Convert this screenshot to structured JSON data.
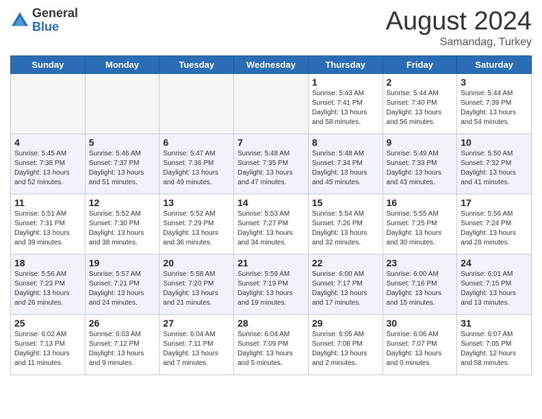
{
  "header": {
    "logo_general": "General",
    "logo_blue": "Blue",
    "title": "August 2024",
    "location": "Samandag, Turkey"
  },
  "days_of_week": [
    "Sunday",
    "Monday",
    "Tuesday",
    "Wednesday",
    "Thursday",
    "Friday",
    "Saturday"
  ],
  "weeks": [
    [
      {
        "day": "",
        "info": ""
      },
      {
        "day": "",
        "info": ""
      },
      {
        "day": "",
        "info": ""
      },
      {
        "day": "",
        "info": ""
      },
      {
        "day": "1",
        "info": "Sunrise: 5:43 AM\nSunset: 7:41 PM\nDaylight: 13 hours\nand 58 minutes."
      },
      {
        "day": "2",
        "info": "Sunrise: 5:44 AM\nSunset: 7:40 PM\nDaylight: 13 hours\nand 56 minutes."
      },
      {
        "day": "3",
        "info": "Sunrise: 5:44 AM\nSunset: 7:39 PM\nDaylight: 13 hours\nand 54 minutes."
      }
    ],
    [
      {
        "day": "4",
        "info": "Sunrise: 5:45 AM\nSunset: 7:38 PM\nDaylight: 13 hours\nand 52 minutes."
      },
      {
        "day": "5",
        "info": "Sunrise: 5:46 AM\nSunset: 7:37 PM\nDaylight: 13 hours\nand 51 minutes."
      },
      {
        "day": "6",
        "info": "Sunrise: 5:47 AM\nSunset: 7:36 PM\nDaylight: 13 hours\nand 49 minutes."
      },
      {
        "day": "7",
        "info": "Sunrise: 5:48 AM\nSunset: 7:35 PM\nDaylight: 13 hours\nand 47 minutes."
      },
      {
        "day": "8",
        "info": "Sunrise: 5:48 AM\nSunset: 7:34 PM\nDaylight: 13 hours\nand 45 minutes."
      },
      {
        "day": "9",
        "info": "Sunrise: 5:49 AM\nSunset: 7:33 PM\nDaylight: 13 hours\nand 43 minutes."
      },
      {
        "day": "10",
        "info": "Sunrise: 5:50 AM\nSunset: 7:32 PM\nDaylight: 13 hours\nand 41 minutes."
      }
    ],
    [
      {
        "day": "11",
        "info": "Sunrise: 5:51 AM\nSunset: 7:31 PM\nDaylight: 13 hours\nand 39 minutes."
      },
      {
        "day": "12",
        "info": "Sunrise: 5:52 AM\nSunset: 7:30 PM\nDaylight: 13 hours\nand 38 minutes."
      },
      {
        "day": "13",
        "info": "Sunrise: 5:52 AM\nSunset: 7:29 PM\nDaylight: 13 hours\nand 36 minutes."
      },
      {
        "day": "14",
        "info": "Sunrise: 5:53 AM\nSunset: 7:27 PM\nDaylight: 13 hours\nand 34 minutes."
      },
      {
        "day": "15",
        "info": "Sunrise: 5:54 AM\nSunset: 7:26 PM\nDaylight: 13 hours\nand 32 minutes."
      },
      {
        "day": "16",
        "info": "Sunrise: 5:55 AM\nSunset: 7:25 PM\nDaylight: 13 hours\nand 30 minutes."
      },
      {
        "day": "17",
        "info": "Sunrise: 5:56 AM\nSunset: 7:24 PM\nDaylight: 13 hours\nand 28 minutes."
      }
    ],
    [
      {
        "day": "18",
        "info": "Sunrise: 5:56 AM\nSunset: 7:23 PM\nDaylight: 13 hours\nand 26 minutes."
      },
      {
        "day": "19",
        "info": "Sunrise: 5:57 AM\nSunset: 7:21 PM\nDaylight: 13 hours\nand 24 minutes."
      },
      {
        "day": "20",
        "info": "Sunrise: 5:58 AM\nSunset: 7:20 PM\nDaylight: 13 hours\nand 21 minutes."
      },
      {
        "day": "21",
        "info": "Sunrise: 5:59 AM\nSunset: 7:19 PM\nDaylight: 13 hours\nand 19 minutes."
      },
      {
        "day": "22",
        "info": "Sunrise: 6:00 AM\nSunset: 7:17 PM\nDaylight: 13 hours\nand 17 minutes."
      },
      {
        "day": "23",
        "info": "Sunrise: 6:00 AM\nSunset: 7:16 PM\nDaylight: 13 hours\nand 15 minutes."
      },
      {
        "day": "24",
        "info": "Sunrise: 6:01 AM\nSunset: 7:15 PM\nDaylight: 13 hours\nand 13 minutes."
      }
    ],
    [
      {
        "day": "25",
        "info": "Sunrise: 6:02 AM\nSunset: 7:13 PM\nDaylight: 13 hours\nand 11 minutes."
      },
      {
        "day": "26",
        "info": "Sunrise: 6:03 AM\nSunset: 7:12 PM\nDaylight: 13 hours\nand 9 minutes."
      },
      {
        "day": "27",
        "info": "Sunrise: 6:04 AM\nSunset: 7:11 PM\nDaylight: 13 hours\nand 7 minutes."
      },
      {
        "day": "28",
        "info": "Sunrise: 6:04 AM\nSunset: 7:09 PM\nDaylight: 13 hours\nand 5 minutes."
      },
      {
        "day": "29",
        "info": "Sunrise: 6:05 AM\nSunset: 7:08 PM\nDaylight: 13 hours\nand 2 minutes."
      },
      {
        "day": "30",
        "info": "Sunrise: 6:06 AM\nSunset: 7:07 PM\nDaylight: 13 hours\nand 0 minutes."
      },
      {
        "day": "31",
        "info": "Sunrise: 6:07 AM\nSunset: 7:05 PM\nDaylight: 12 hours\nand 58 minutes."
      }
    ]
  ]
}
